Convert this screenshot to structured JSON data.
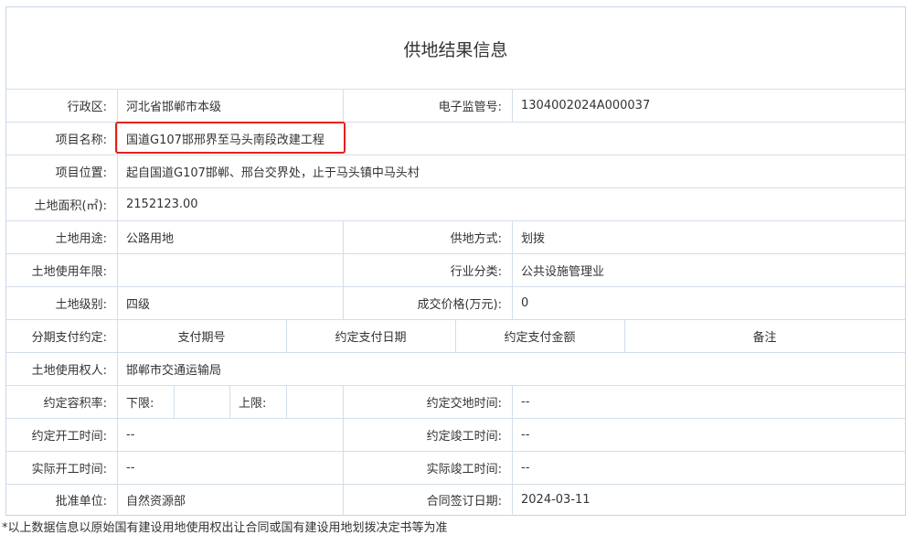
{
  "title": "供地结果信息",
  "fields": {
    "admin_region_label": "行政区:",
    "admin_region_value": "河北省邯郸市本级",
    "supervision_no_label": "电子监管号:",
    "supervision_no_value": "1304002024A000037",
    "project_name_label": "项目名称:",
    "project_name_value": "国道G107邯邢界至马头南段改建工程",
    "project_location_label": "项目位置:",
    "project_location_value": "起自国道G107邯郸、邢台交界处，止于马头镇中马头村",
    "land_area_label": "土地面积(㎡):",
    "land_area_value": "2152123.00",
    "land_use_label": "土地用途:",
    "land_use_value": "公路用地",
    "supply_method_label": "供地方式:",
    "supply_method_value": "划拨",
    "use_term_label": "土地使用年限:",
    "use_term_value": "",
    "industry_label": "行业分类:",
    "industry_value": "公共设施管理业",
    "land_grade_label": "土地级别:",
    "land_grade_value": "四级",
    "price_label": "成交价格(万元):",
    "price_value": "0",
    "installment_label": "分期支付约定:",
    "installment_headers": [
      "支付期号",
      "约定支付日期",
      "约定支付金额",
      "备注"
    ],
    "land_user_label": "土地使用权人:",
    "land_user_value": "邯郸市交通运输局",
    "far_label": "约定容积率:",
    "far_lower_label": "下限:",
    "far_lower_value": "",
    "far_upper_label": "上限:",
    "far_upper_value": "",
    "delivery_time_label": "约定交地时间:",
    "delivery_time_value": "--",
    "agreed_start_label": "约定开工时间:",
    "agreed_start_value": "--",
    "agreed_finish_label": "约定竣工时间:",
    "agreed_finish_value": "--",
    "actual_start_label": "实际开工时间:",
    "actual_start_value": "--",
    "actual_finish_label": "实际竣工时间:",
    "actual_finish_value": "--",
    "approval_unit_label": "批准单位:",
    "approval_unit_value": "自然资源部",
    "contract_date_label": "合同签订日期:",
    "contract_date_value": "2024-03-11"
  },
  "footnote": "*以上数据信息以原始国有建设用地使用权出让合同或国有建设用地划拨决定书等为准",
  "colors": {
    "border": "#d3deea",
    "highlight": "#e5201b",
    "text": "#333333"
  }
}
